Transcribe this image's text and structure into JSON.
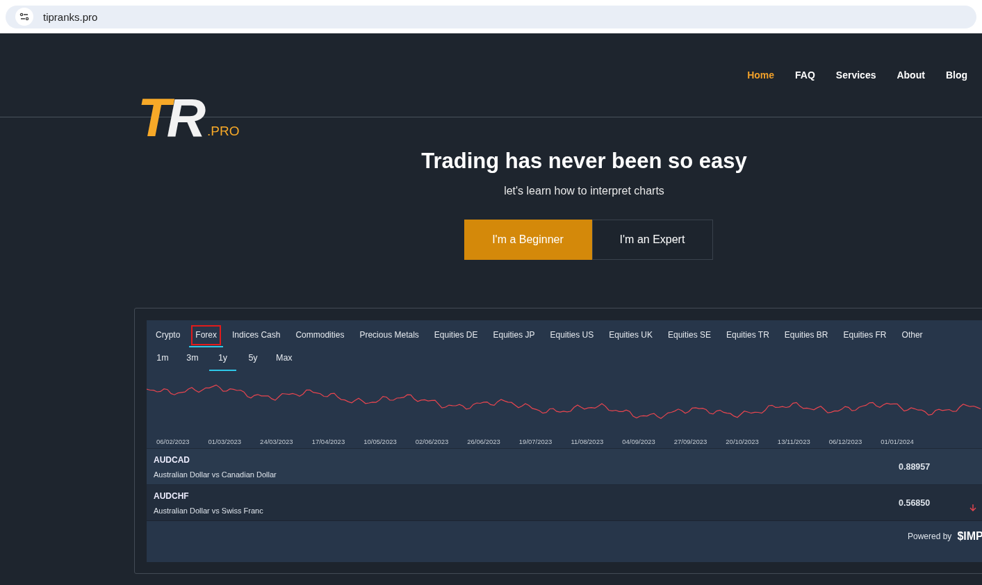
{
  "browser": {
    "address": "tipranks.pro"
  },
  "nav": [
    {
      "label": "Home",
      "selected": true
    },
    {
      "label": "FAQ",
      "selected": false
    },
    {
      "label": "Services",
      "selected": false
    },
    {
      "label": "About",
      "selected": false
    },
    {
      "label": "Blog",
      "selected": false
    }
  ],
  "logo": {
    "mark_1": "T",
    "mark_2": "R",
    "suffix": ".PRO"
  },
  "hero": {
    "title": "Trading has never been so easy",
    "subtitle": "let's learn how to interpret charts",
    "buttons": [
      {
        "label": "I'm a Beginner",
        "kind": "primary"
      },
      {
        "label": "I'm an Expert",
        "kind": "secondary"
      }
    ]
  },
  "widget": {
    "tabs": [
      {
        "label": "Crypto",
        "selected": false,
        "annotated": false
      },
      {
        "label": "Forex",
        "selected": true,
        "annotated": true
      },
      {
        "label": "Indices Cash",
        "selected": false,
        "annotated": false
      },
      {
        "label": "Commodities",
        "selected": false,
        "annotated": false
      },
      {
        "label": "Precious Metals",
        "selected": false,
        "annotated": false
      },
      {
        "label": "Equities DE",
        "selected": false,
        "annotated": false
      },
      {
        "label": "Equities JP",
        "selected": false,
        "annotated": false
      },
      {
        "label": "Equities US",
        "selected": false,
        "annotated": false
      },
      {
        "label": "Equities UK",
        "selected": false,
        "annotated": false
      },
      {
        "label": "Equities SE",
        "selected": false,
        "annotated": false
      },
      {
        "label": "Equities TR",
        "selected": false,
        "annotated": false
      },
      {
        "label": "Equities BR",
        "selected": false,
        "annotated": false
      },
      {
        "label": "Equities FR",
        "selected": false,
        "annotated": false
      },
      {
        "label": "Other",
        "selected": false,
        "annotated": false
      }
    ],
    "ranges": [
      {
        "label": "1m",
        "selected": false
      },
      {
        "label": "3m",
        "selected": false
      },
      {
        "label": "1y",
        "selected": true
      },
      {
        "label": "5y",
        "selected": false
      },
      {
        "label": "Max",
        "selected": false
      }
    ],
    "date_labels": [
      "06/02/2023",
      "01/03/2023",
      "24/03/2023",
      "17/04/2023",
      "10/05/2023",
      "02/06/2023",
      "26/06/2023",
      "19/07/2023",
      "11/08/2023",
      "04/09/2023",
      "27/09/2023",
      "20/10/2023",
      "13/11/2023",
      "06/12/2023",
      "01/01/2024"
    ],
    "rows": [
      {
        "symbol": "AUDCAD",
        "name": "Australian Dollar vs Canadian Dollar",
        "price": "0.88957",
        "falling": false
      },
      {
        "symbol": "AUDCHF",
        "name": "Australian Dollar vs Swiss Franc",
        "price": "0.56850",
        "falling": true
      }
    ],
    "footer": {
      "powered_by": "Powered by",
      "brand": "$IMP"
    }
  }
}
